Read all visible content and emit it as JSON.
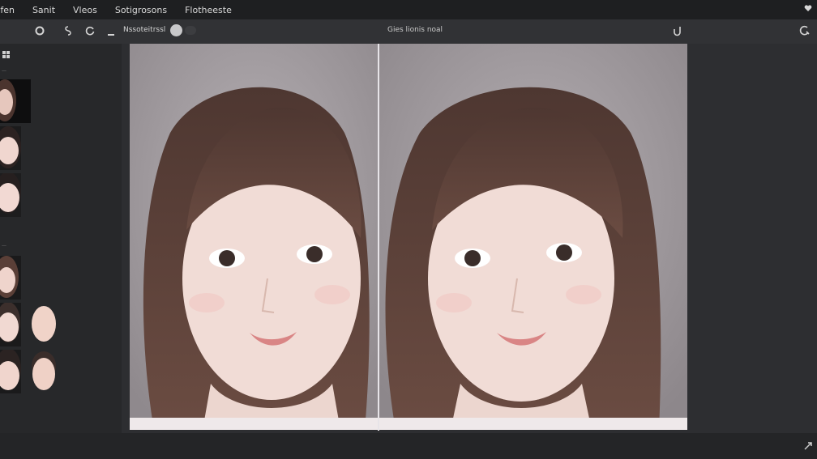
{
  "menubar": {
    "items": [
      {
        "label": "Ffen"
      },
      {
        "label": "Sanit"
      },
      {
        "label": "Vleos"
      },
      {
        "label": "Sotigrosons"
      },
      {
        "label": "Flotheeste"
      }
    ]
  },
  "toolbar": {
    "slider_label": "Nssoteitrssl",
    "document_title": "Gies lionis noal"
  },
  "icons": {
    "heart": "heart-icon",
    "lasso": "lasso-icon",
    "pen": "pen-tool-icon",
    "reset": "reset-icon",
    "minus": "minus-icon",
    "undo": "undo-icon",
    "redo": "redo-icon",
    "grid": "grid-icon",
    "expand": "expand-icon"
  },
  "colors": {
    "background": "#2a2b2d",
    "menubar": "#1e1f21",
    "toolbar": "#313235",
    "photo_backdrop": "#a09a9e",
    "hair": "#5a3f37",
    "skin": "#f0d9d3",
    "divider": "#e7e4e8"
  }
}
